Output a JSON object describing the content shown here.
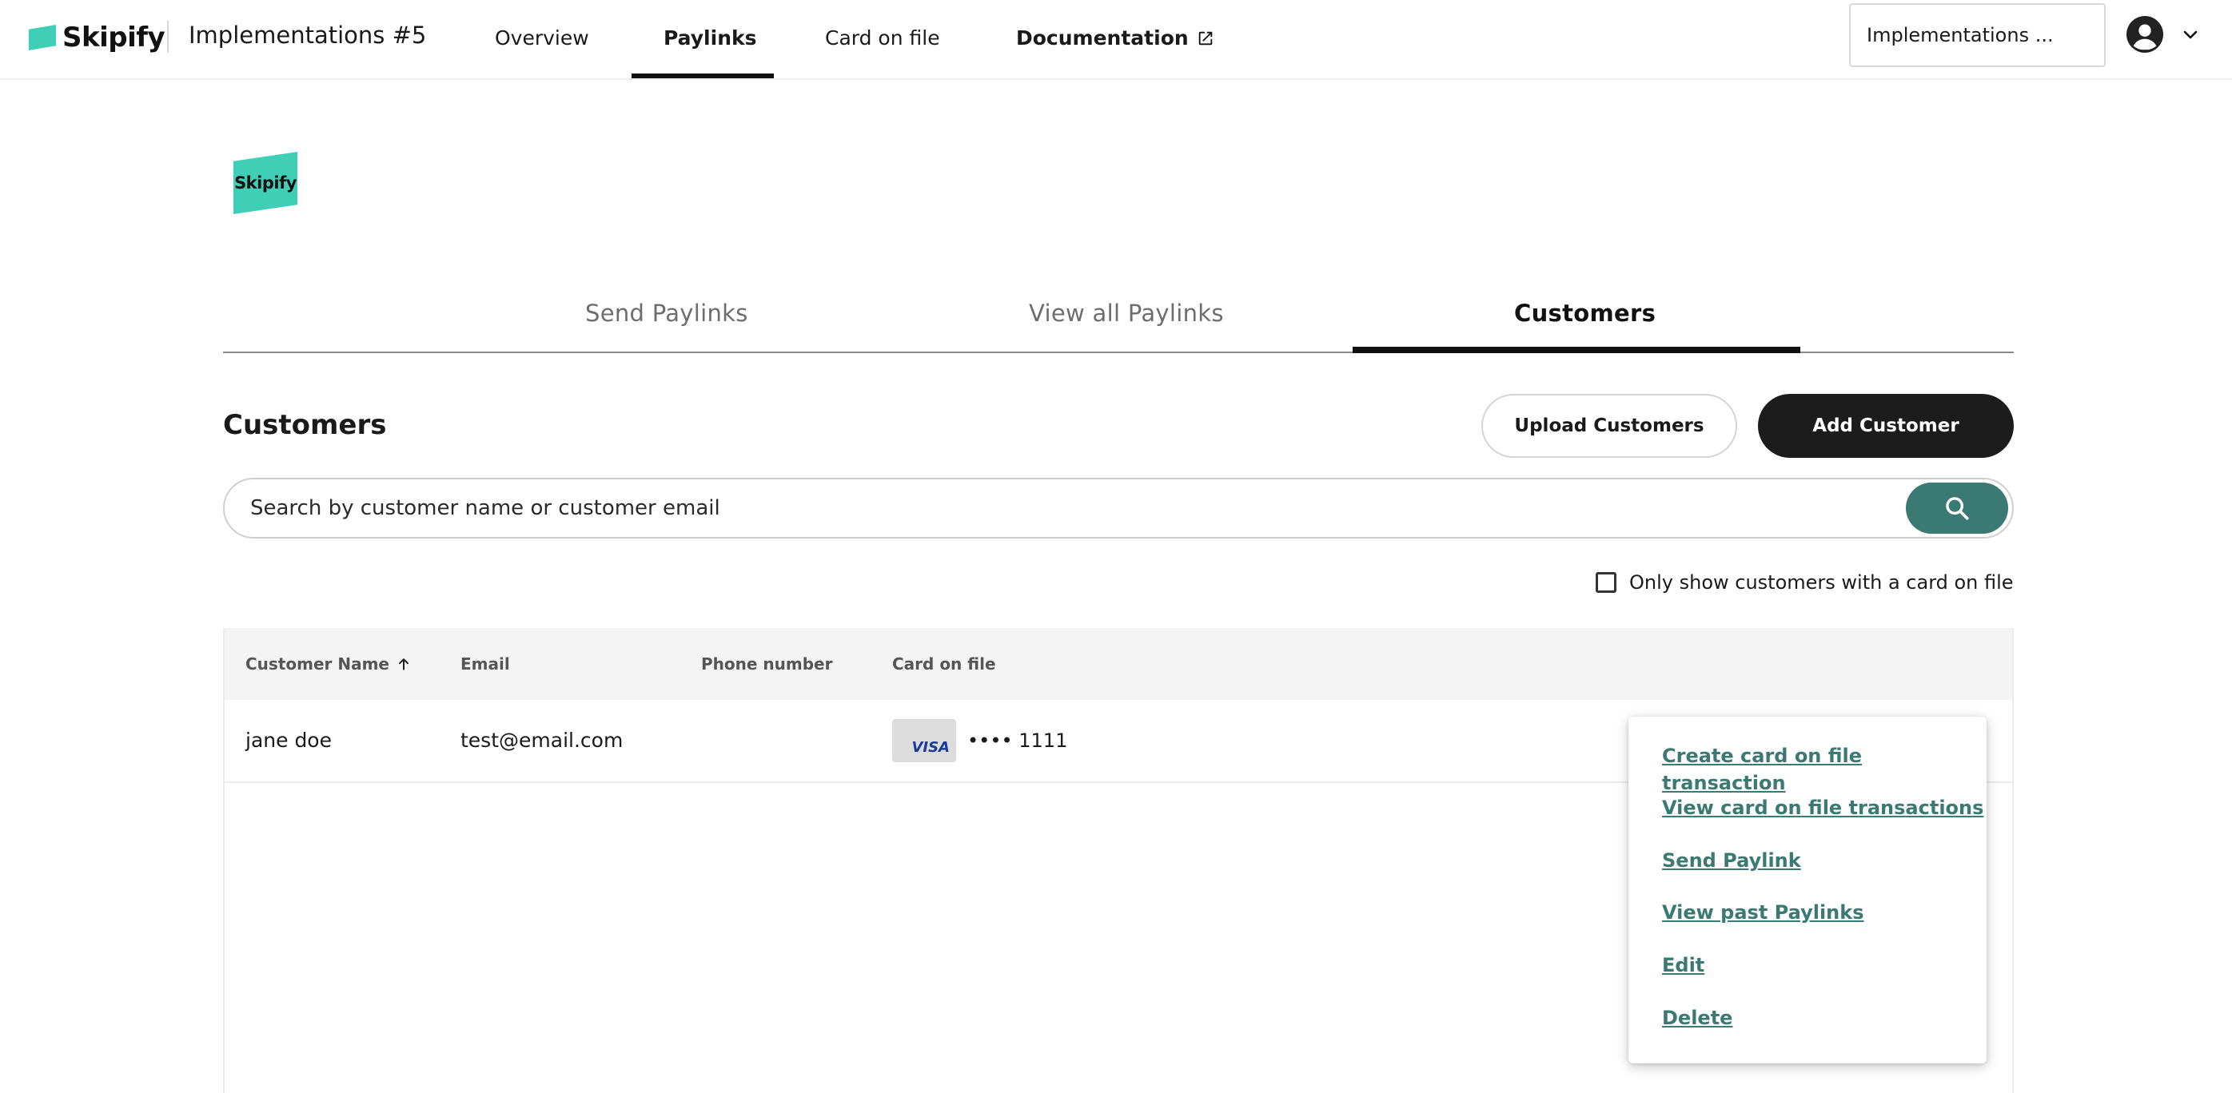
{
  "header": {
    "brand": "Skipify",
    "implementation_title": "Implementations #5",
    "nav": {
      "overview": "Overview",
      "paylinks": "Paylinks",
      "card_on_file": "Card on file",
      "documentation": "Documentation"
    },
    "implementation_select": "Implementations ..."
  },
  "merchant_logo_text": "Skipify",
  "subtabs": {
    "send": "Send Paylinks",
    "view_all": "View all Paylinks",
    "customers": "Customers"
  },
  "customers": {
    "title": "Customers",
    "upload_label": "Upload Customers",
    "add_label": "Add Customer",
    "search_placeholder": "Search by customer name or customer email",
    "filter_label": "Only show customers with a card on file"
  },
  "table": {
    "columns": {
      "name": "Customer Name",
      "email": "Email",
      "phone": "Phone number",
      "card": "Card on file"
    },
    "rows": [
      {
        "name": "jane doe",
        "email": "test@email.com",
        "phone": "",
        "card_brand": "VISA",
        "card_number": "•••• 1111"
      }
    ]
  },
  "row_menu": {
    "items": [
      "Create card on file transaction",
      "View card on file transactions",
      "Send Paylink",
      "View past Paylinks",
      "Edit",
      "Delete"
    ]
  },
  "colors": {
    "brand_teal": "#3ecfb6",
    "accent_green": "#3a7a72",
    "dark_button": "#1c1c1c"
  }
}
